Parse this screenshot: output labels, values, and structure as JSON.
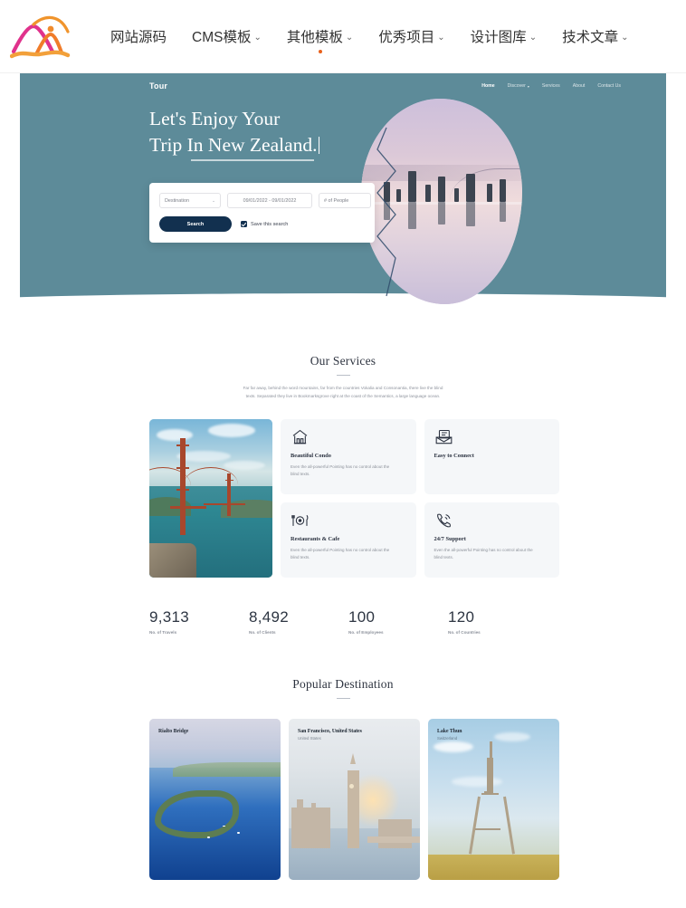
{
  "topnav": {
    "logo_name": "site-logo",
    "items": [
      {
        "label": "网站源码",
        "has_caret": false,
        "has_dot": false
      },
      {
        "label": "CMS模板",
        "has_caret": true,
        "has_dot": false
      },
      {
        "label": "其他模板",
        "has_caret": true,
        "has_dot": true
      },
      {
        "label": "优秀项目",
        "has_caret": true,
        "has_dot": false
      },
      {
        "label": "设计图库",
        "has_caret": true,
        "has_dot": false
      },
      {
        "label": "技术文章",
        "has_caret": true,
        "has_dot": false
      }
    ],
    "caret_glyph": "⌄",
    "dot_color": "#e8611c"
  },
  "hero": {
    "brand": "Tour",
    "menu": [
      {
        "label": "Home",
        "active": true,
        "caret": false
      },
      {
        "label": "Discover",
        "active": false,
        "caret": true
      },
      {
        "label": "Services",
        "active": false,
        "caret": false
      },
      {
        "label": "About",
        "active": false,
        "caret": false
      },
      {
        "label": "Contact Us",
        "active": false,
        "caret": false
      }
    ],
    "title_line1": "Let's Enjoy Your",
    "title_line2": "Trip In New Zealand.",
    "background_color": "#5d8b99",
    "search": {
      "destination_value": "Destination",
      "destination_caret": "⌄",
      "date_value": "09/01/2022 - 09/01/2022",
      "people_value": "# of People",
      "search_button": "Search",
      "save_checkbox_label": "Save this search",
      "save_checkbox_checked": true,
      "button_color": "#12304f"
    }
  },
  "services": {
    "title": "Our Services",
    "description": "Far far away, behind the word mountains, far from the countries Vokalia and Consonantia, there live the blind texts. Separated they live in Bookmarksgrove right at the coast of the Semantics, a large language ocean.",
    "photo_alt": "golden-gate-bridge-photo",
    "cards": [
      {
        "icon": "house-icon",
        "name": "Beautiful Condo",
        "desc": "Even the all-powerful Pointing has no control about the blind texts."
      },
      {
        "icon": "envelope-mail-icon",
        "name": "Easy to Connect",
        "desc": ""
      },
      {
        "icon": "restaurant-cutlery-icon",
        "name": "Restaurants & Cafe",
        "desc": "Even the all-powerful Pointing has no control about the blind texts."
      },
      {
        "icon": "phone-support-icon",
        "name": "24/7 Support",
        "desc": "Even the all-powerful Pointing has no control about the blind texts."
      }
    ]
  },
  "stats": [
    {
      "number": "9,313",
      "label": "No. of Travels"
    },
    {
      "number": "8,492",
      "label": "No. of Clients"
    },
    {
      "number": "100",
      "label": "No. of Employees"
    },
    {
      "number": "120",
      "label": "No. of Countries"
    }
  ],
  "destinations": {
    "title": "Popular Destination",
    "cards": [
      {
        "title": "Rialto Bridge",
        "subtitle": "",
        "image_alt": "island-bay-aerial-photo"
      },
      {
        "title": "San Francisco, United States",
        "subtitle": "United States",
        "image_alt": "london-big-ben-photo"
      },
      {
        "title": "Lake Thun",
        "subtitle": "Switzerland",
        "image_alt": "eiffel-tower-photo"
      }
    ]
  }
}
